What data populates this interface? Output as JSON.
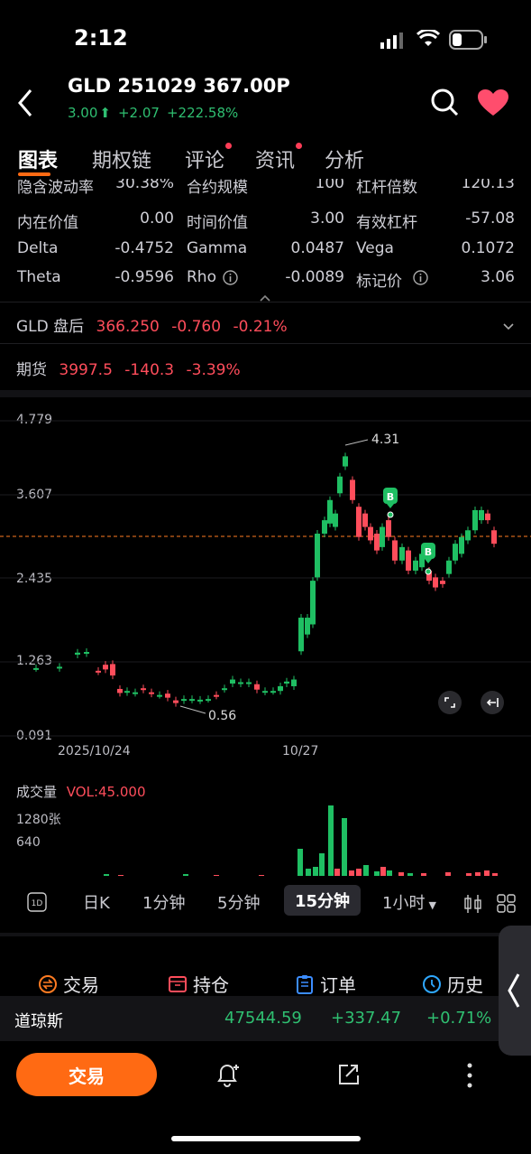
{
  "status": {
    "time": "2:12"
  },
  "header": {
    "title": "GLD 251029 367.00P",
    "price": "3.00",
    "change": "+2.07",
    "change_pct": "+222.58%",
    "favorite_color": "#ff4d6d"
  },
  "tabs": [
    {
      "label": "图表",
      "active": true
    },
    {
      "label": "期权链"
    },
    {
      "label": "评论",
      "dot": true
    },
    {
      "label": "资讯",
      "dot": true
    },
    {
      "label": "分析"
    }
  ],
  "stats": {
    "cut_row": {
      "l1": "隐含波动率",
      "v1": "30.38%",
      "l2": "合约规模",
      "v2": "100",
      "l3": "杠杆倍数",
      "v3": "120.13"
    },
    "row1": {
      "l1": "内在价值",
      "v1": "0.00",
      "l2": "时间价值",
      "v2": "3.00",
      "l3": "有效杠杆",
      "v3": "-57.08"
    },
    "row2": {
      "l1": "Delta",
      "v1": "-0.4752",
      "l2": "Gamma",
      "v2": "0.0487",
      "l3": "Vega",
      "v3": "0.1072"
    },
    "row3": {
      "l1": "Theta",
      "v1": "-0.9596",
      "l2": "Rho",
      "v2": "-0.0089",
      "l3": "标记价",
      "v3": "3.06"
    }
  },
  "underlying": {
    "label": "GLD 盘后",
    "price": "366.250",
    "change": "-0.760",
    "pct": "-0.21%"
  },
  "futures": {
    "label": "期货",
    "price": "3997.5",
    "change": "-140.3",
    "pct": "-3.39%"
  },
  "chart": {
    "y_ticks": [
      "4.779",
      "3.607",
      "2.435",
      "1.263",
      "0.091"
    ],
    "x_ticks": [
      "2025/10/24",
      "10/27"
    ],
    "high_label": "4.31",
    "low_label": "0.56",
    "marker_label": "B",
    "current_level": 3.0
  },
  "chart_data": {
    "type": "candlestick",
    "ylim": [
      0.091,
      4.779
    ],
    "x_labels": [
      "2025/10/24",
      "10/27"
    ],
    "high": 4.31,
    "low": 0.56,
    "reference_line": 3.0
  },
  "volume": {
    "label": "成交量",
    "value": "VOL:45.000",
    "ticks": [
      "1280张",
      "640"
    ]
  },
  "periods": [
    "1D",
    "日K",
    "1分钟",
    "5分钟",
    "15分钟",
    "1小时"
  ],
  "active_period": "15分钟",
  "bottom_tabs": [
    {
      "label": "交易",
      "icon": "trade-icon"
    },
    {
      "label": "持仓",
      "icon": "position-icon"
    },
    {
      "label": "订单",
      "icon": "order-icon"
    },
    {
      "label": "历史",
      "icon": "history-icon"
    }
  ],
  "ticker": {
    "name": "道琼斯",
    "price": "47544.59",
    "change": "+337.47",
    "pct": "+0.71%"
  },
  "trade_button": "交易"
}
